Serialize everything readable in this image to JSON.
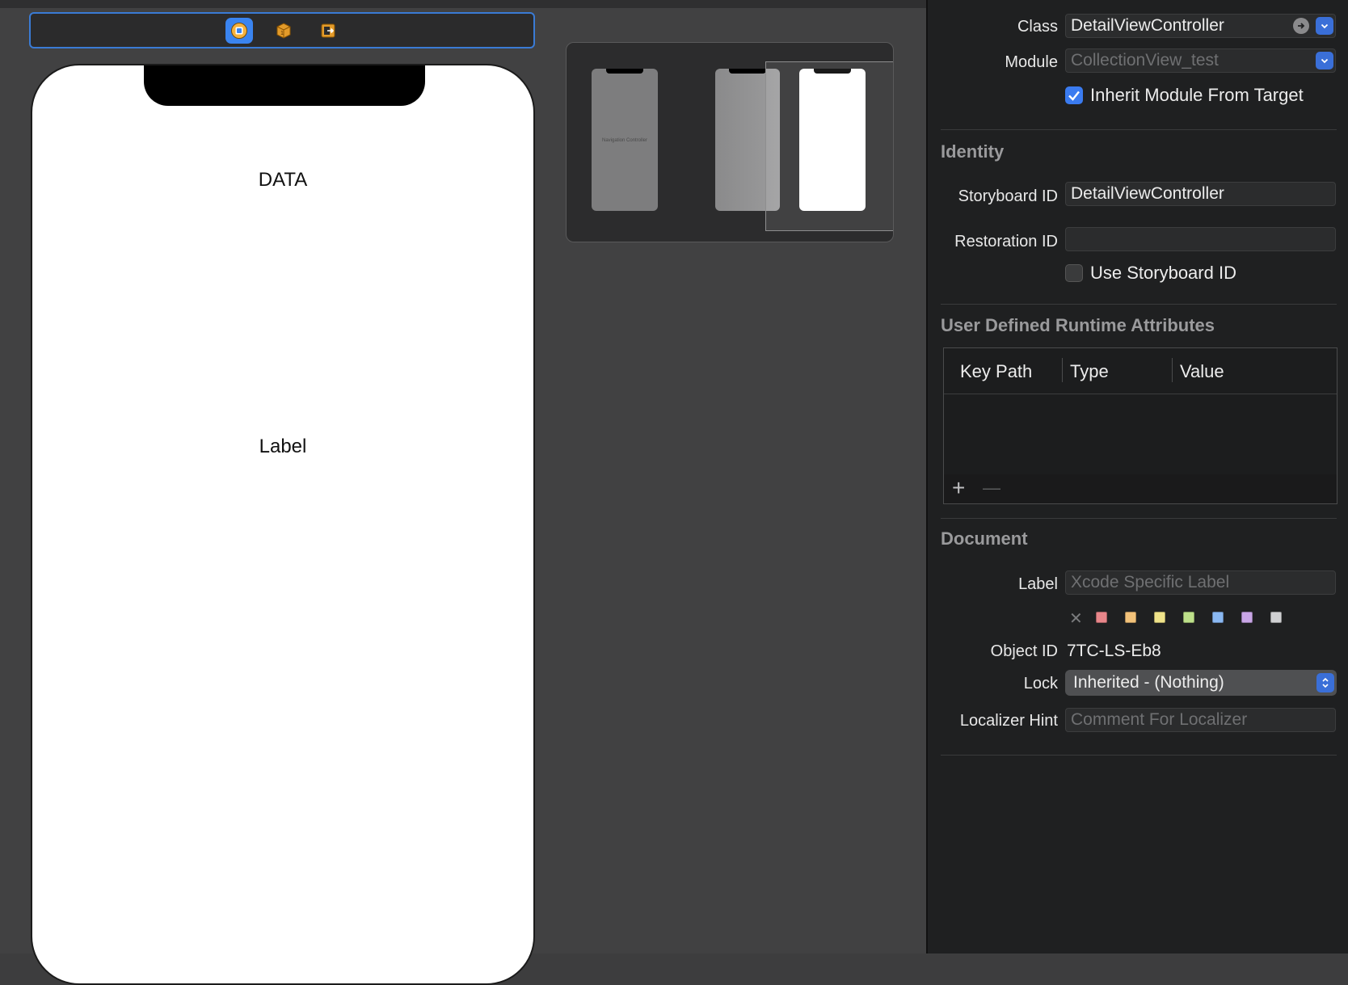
{
  "canvas": {
    "phone_labels": {
      "data": "DATA",
      "label": "Label"
    },
    "minimap": {
      "nav_controller_text": "Navigation Controller"
    }
  },
  "inspector": {
    "custom_class": {
      "class_label": "Class",
      "class_value": "DetailViewController",
      "module_label": "Module",
      "module_placeholder": "CollectionView_test",
      "inherit_label": "Inherit Module From Target",
      "inherit_checked": true
    },
    "identity": {
      "title": "Identity",
      "storyboard_id_label": "Storyboard ID",
      "storyboard_id_value": "DetailViewController",
      "restoration_id_label": "Restoration ID",
      "restoration_id_value": "",
      "use_storyboard_id_label": "Use Storyboard ID",
      "use_storyboard_id_checked": false
    },
    "runtime_attributes": {
      "title": "User Defined Runtime Attributes",
      "columns": [
        "Key Path",
        "Type",
        "Value"
      ],
      "add_symbol": "+",
      "remove_symbol": "—"
    },
    "document": {
      "title": "Document",
      "label_label": "Label",
      "label_placeholder": "Xcode Specific Label",
      "clear_symbol": "✕",
      "label_colors": [
        "#e8868a",
        "#f2c27a",
        "#efe38a",
        "#bde08a",
        "#8ab8f2",
        "#c9a6e6",
        "#cfd0d2"
      ],
      "object_id_label": "Object ID",
      "object_id_value": "7TC-LS-Eb8",
      "lock_label": "Lock",
      "lock_value": "Inherited - (Nothing)",
      "localizer_hint_label": "Localizer Hint",
      "localizer_hint_placeholder": "Comment For Localizer"
    }
  },
  "colors": {
    "accent": "#3a7bf0",
    "selection_border": "#3a7bd5"
  }
}
